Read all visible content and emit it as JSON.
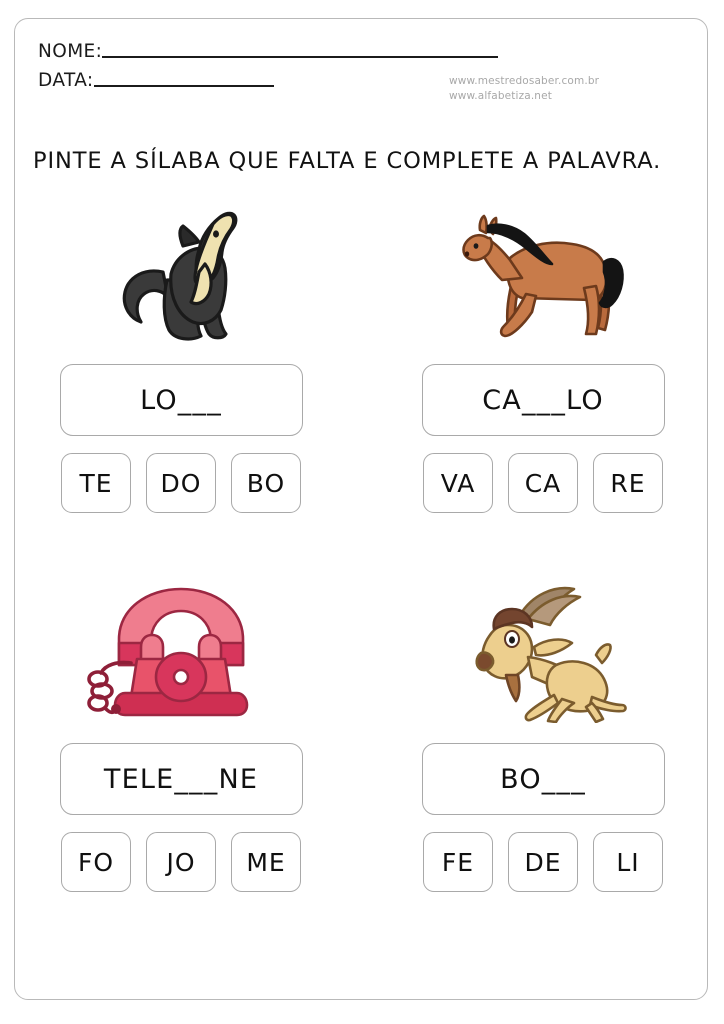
{
  "page": {
    "title": "Pinte a sílaba que falta e complete a palavra",
    "background_color": "#ffffff",
    "frame_color": "#b9b9b9"
  },
  "header": {
    "name_label": "NOME:",
    "date_label": "DATA:",
    "credit_line_1": "www.mestredosaber.com.br",
    "credit_line_2": "www.alfabetiza.net",
    "credit_color": "#a8a8a8"
  },
  "instruction": {
    "text": "PINTE A SÍLABA QUE FALTA E COMPLETE A PALAVRA."
  },
  "exercises": [
    {
      "id": "wolf",
      "illustration": "wolf-howling-icon",
      "word": "LO___",
      "syllables": [
        "TE",
        "DO",
        "BO"
      ],
      "colors": {
        "body": "#3a3a3a",
        "muzzle": "#efe2b0",
        "outline": "#1a1a1a"
      }
    },
    {
      "id": "horse",
      "illustration": "horse-icon",
      "word": "CA___LO",
      "syllables": [
        "VA",
        "CA",
        "RE"
      ],
      "colors": {
        "body": "#c87b4a",
        "mane": "#141414",
        "outline": "#6d3a1c"
      }
    },
    {
      "id": "telephone",
      "illustration": "rotary-telephone-icon",
      "word": "TELE___NE",
      "syllables": [
        "FO",
        "JO",
        "ME"
      ],
      "colors": {
        "top": "#ef7d8e",
        "body": "#e8536a",
        "base": "#cf2f52",
        "cord": "#8e1f38",
        "outline": "#9c2742"
      }
    },
    {
      "id": "goat",
      "illustration": "goat-icon",
      "word": "BO___",
      "syllables": [
        "FE",
        "DE",
        "LI"
      ],
      "colors": {
        "body": "#edcf8e",
        "horns": "#a08568",
        "hair": "#74452f",
        "outline": "#7b5c2e"
      }
    }
  ]
}
